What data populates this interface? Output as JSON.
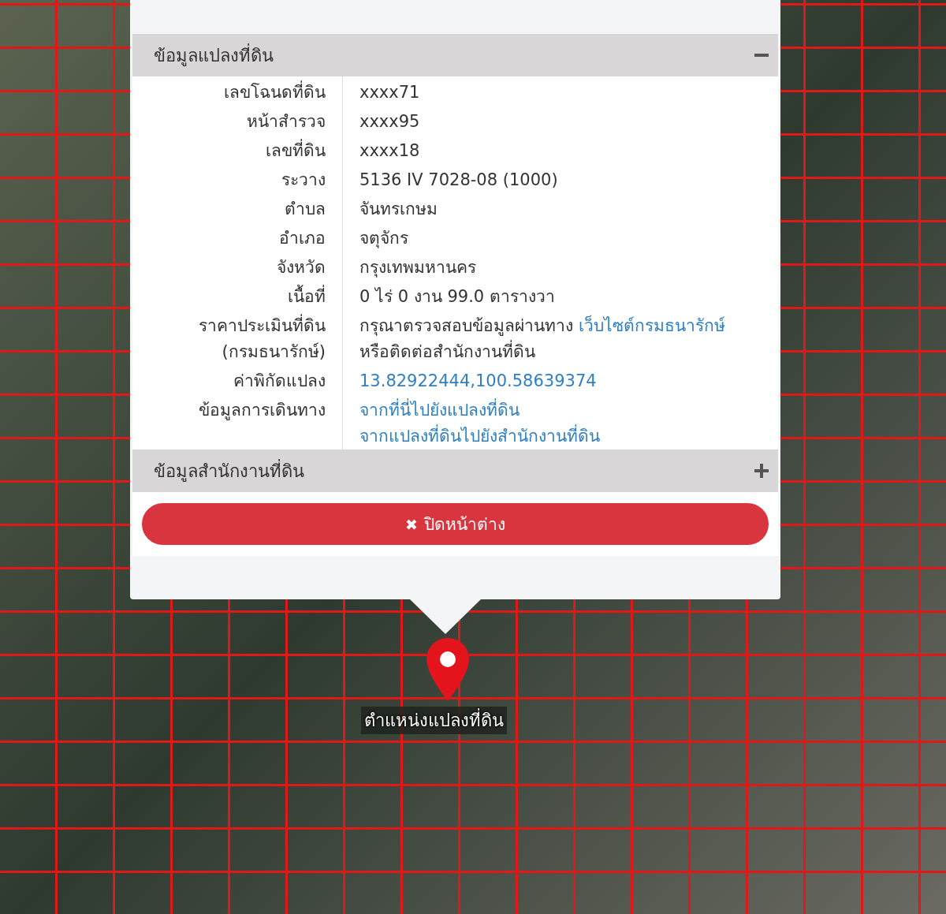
{
  "popup": {
    "sections": [
      {
        "title": "ข้อมูลแปลงที่ดิน",
        "expanded": true,
        "rows": [
          {
            "label": [
              "เลขโฉนดที่ดิน"
            ],
            "value": [
              [
                {
                  "kind": "text",
                  "text": "xxxx71"
                }
              ]
            ]
          },
          {
            "label": [
              "หน้าสำรวจ"
            ],
            "value": [
              [
                {
                  "kind": "text",
                  "text": "xxxx95"
                }
              ]
            ]
          },
          {
            "label": [
              "เลขที่ดิน"
            ],
            "value": [
              [
                {
                  "kind": "text",
                  "text": "xxxx18"
                }
              ]
            ]
          },
          {
            "label": [
              "ระวาง"
            ],
            "value": [
              [
                {
                  "kind": "text",
                  "text": "5136 IV 7028-08 (1000)"
                }
              ]
            ]
          },
          {
            "label": [
              "ตำบล"
            ],
            "value": [
              [
                {
                  "kind": "text",
                  "text": "จันทรเกษม"
                }
              ]
            ]
          },
          {
            "label": [
              "อำเภอ"
            ],
            "value": [
              [
                {
                  "kind": "text",
                  "text": "จตุจักร"
                }
              ]
            ]
          },
          {
            "label": [
              "จังหวัด"
            ],
            "value": [
              [
                {
                  "kind": "text",
                  "text": "กรุงเทพมหานคร"
                }
              ]
            ]
          },
          {
            "label": [
              "เนื้อที่"
            ],
            "value": [
              [
                {
                  "kind": "text",
                  "text": "0 ไร่ 0 งาน 99.0 ตารางวา"
                }
              ]
            ]
          },
          {
            "label": [
              "ราคาประเมินที่ดิน",
              "(กรมธนารักษ์)"
            ],
            "value": [
              [
                {
                  "kind": "text",
                  "text": "กรุณาตรวจสอบข้อมูลผ่านทาง"
                },
                {
                  "kind": "link",
                  "text": "เว็บไซต์กรมธนารักษ์"
                }
              ],
              [
                {
                  "kind": "text",
                  "text": "หรือติดต่อสำนักงานที่ดิน"
                }
              ]
            ]
          },
          {
            "label": [
              "ค่าพิกัดแปลง"
            ],
            "value": [
              [
                {
                  "kind": "link",
                  "text": "13.82922444,100.58639374"
                }
              ]
            ]
          },
          {
            "label": [
              "ข้อมูลการเดินทาง"
            ],
            "value": [
              [
                {
                  "kind": "link",
                  "text": "จากที่นี่ไปยังแปลงที่ดิน"
                }
              ],
              [
                {
                  "kind": "link",
                  "text": "จากแปลงที่ดินไปยังสำนักงานที่ดิน"
                }
              ]
            ]
          }
        ]
      },
      {
        "title": "ข้อมูลสำนักงานที่ดิน",
        "expanded": false
      }
    ],
    "close_button": {
      "icon": "✖",
      "label": "ปิดหน้าต่าง"
    }
  },
  "marker": {
    "label": "ตำแหน่งแปลงที่ดิน"
  }
}
